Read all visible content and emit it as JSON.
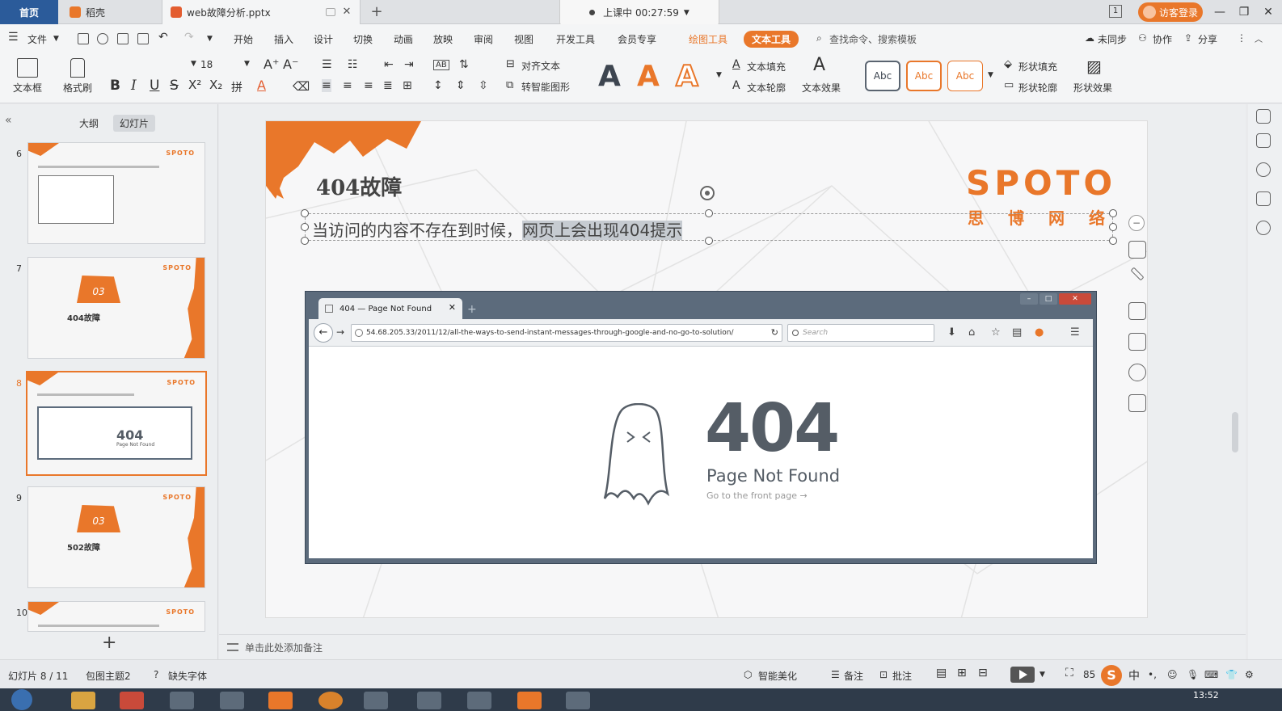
{
  "tabs": {
    "home": "首页",
    "daoke": "稻壳",
    "file": "web故障分析.pptx"
  },
  "class_status": "上课中 00:27:59",
  "login": "访客登录",
  "tab_count": "1",
  "menu": {
    "file": "文件",
    "items": [
      "开始",
      "插入",
      "设计",
      "切换",
      "动画",
      "放映",
      "审阅",
      "视图",
      "开发工具",
      "会员专享"
    ],
    "draw_tools": "绘图工具",
    "text_tools": "文本工具",
    "search": "查找命令、搜索模板",
    "unsynced": "未同步",
    "collab": "协作",
    "share": "分享"
  },
  "ribbon": {
    "textbox": "文本框",
    "format_painter": "格式刷",
    "font_size": "18",
    "align_text": "对齐文本",
    "smart_shape": "转智能图形",
    "text_fill": "文本填充",
    "text_outline": "文本轮廓",
    "text_effect": "文本效果",
    "abc": "Abc",
    "shape_fill": "形状填充",
    "shape_outline": "形状轮廓",
    "shape_effect": "形状效果",
    "bold": "B",
    "italic": "I",
    "underline": "U",
    "strike": "S",
    "sup": "X²",
    "sub": "X₂",
    "big_a": "A"
  },
  "left_panel": {
    "outline_tab": "大纲",
    "slides_tab": "幻灯片",
    "slides": [
      {
        "num": "6",
        "logo": "SPOTO"
      },
      {
        "num": "7",
        "logo": "SPOTO",
        "blob": "03",
        "title": "404故障"
      },
      {
        "num": "8",
        "logo": "SPOTO",
        "code": "404",
        "sub": "Page Not Found"
      },
      {
        "num": "9",
        "logo": "SPOTO",
        "blob": "03",
        "title": "502故障"
      },
      {
        "num": "10",
        "logo": "SPOTO"
      }
    ]
  },
  "slide": {
    "title": "404故障",
    "logo": "SPOTO",
    "logo_reg": "R",
    "logo_sub": "思博网络",
    "text_normal": "当访问的内容不存在到时候，",
    "text_selected": "网页上会出现404提示"
  },
  "browser": {
    "tab_title": "404 — Page Not Found",
    "url": "54.68.205.33/2011/12/all-the-ways-to-send-instant-messages-through-google-and-no-go-to-solution/",
    "search_placeholder": "Search",
    "error_code": "404",
    "error_title": "Page Not Found",
    "error_link": "Go to the front page →"
  },
  "notes_placeholder": "单击此处添加备注",
  "status": {
    "slide_count": "幻灯片 8 / 11",
    "theme": "包图主题2",
    "missing_font": "缺失字体",
    "smart_beautify": "智能美化",
    "notes": "备注",
    "comments": "批注",
    "zoom": "85",
    "ime": "中"
  },
  "taskbar": {
    "time": "13:52"
  }
}
